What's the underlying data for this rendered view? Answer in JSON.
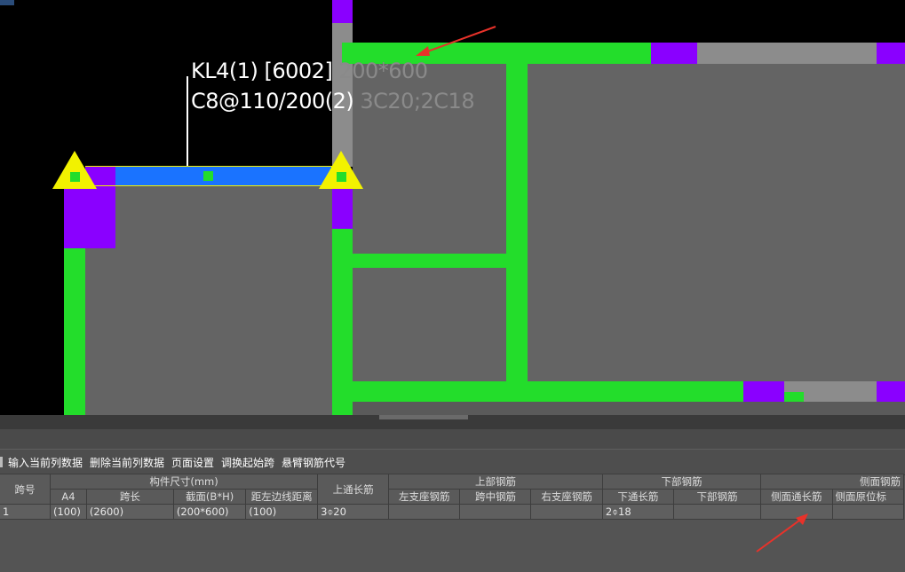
{
  "canvas": {
    "beam_label_line1_main": "KL4(1) [6002]",
    "beam_label_line1_dim": "200*600",
    "beam_label_line2_main": "C8@110/200(2)",
    "beam_label_line2_dim": "3C20;2C18"
  },
  "toolbar": {
    "items": [
      "输入当前列数据",
      "删除当前列数据",
      "页面设置",
      "调换起始跨",
      "悬臂钢筋代号"
    ]
  },
  "table": {
    "group_headers": {
      "span_no": "跨号",
      "component_size": "构件尺寸(mm)",
      "top_through": "上通长筋",
      "top_rebar": "上部钢筋",
      "bottom_rebar": "下部钢筋",
      "side_rebar": "侧面钢筋"
    },
    "sub_headers": {
      "a4": "A4",
      "span_length": "跨长",
      "section": "截面(B*H)",
      "edge_distance": "距左边线距离",
      "left_support": "左支座钢筋",
      "mid_span": "跨中钢筋",
      "right_support": "右支座钢筋",
      "bottom_through": "下通长筋",
      "bottom_part": "下部钢筋",
      "side_through": "侧面通长筋",
      "side_origin": "侧面原位标"
    },
    "row": {
      "span_no": "1",
      "a4": "(100)",
      "span_length": "(2600)",
      "section": "(200*600)",
      "edge_distance": "(100)",
      "top_through": "3⌽20",
      "left_support": "",
      "mid_span": "",
      "right_support": "",
      "bottom_through": "2⌽18",
      "bottom_part": "",
      "side_through": "",
      "side_origin": ""
    }
  },
  "colors": {
    "column_green": "#23dd2b",
    "column_purple": "#8a00ff",
    "beam_blue": "#1a73ff",
    "support_yellow": "#f2f200",
    "arrow_red": "#e8322a"
  }
}
